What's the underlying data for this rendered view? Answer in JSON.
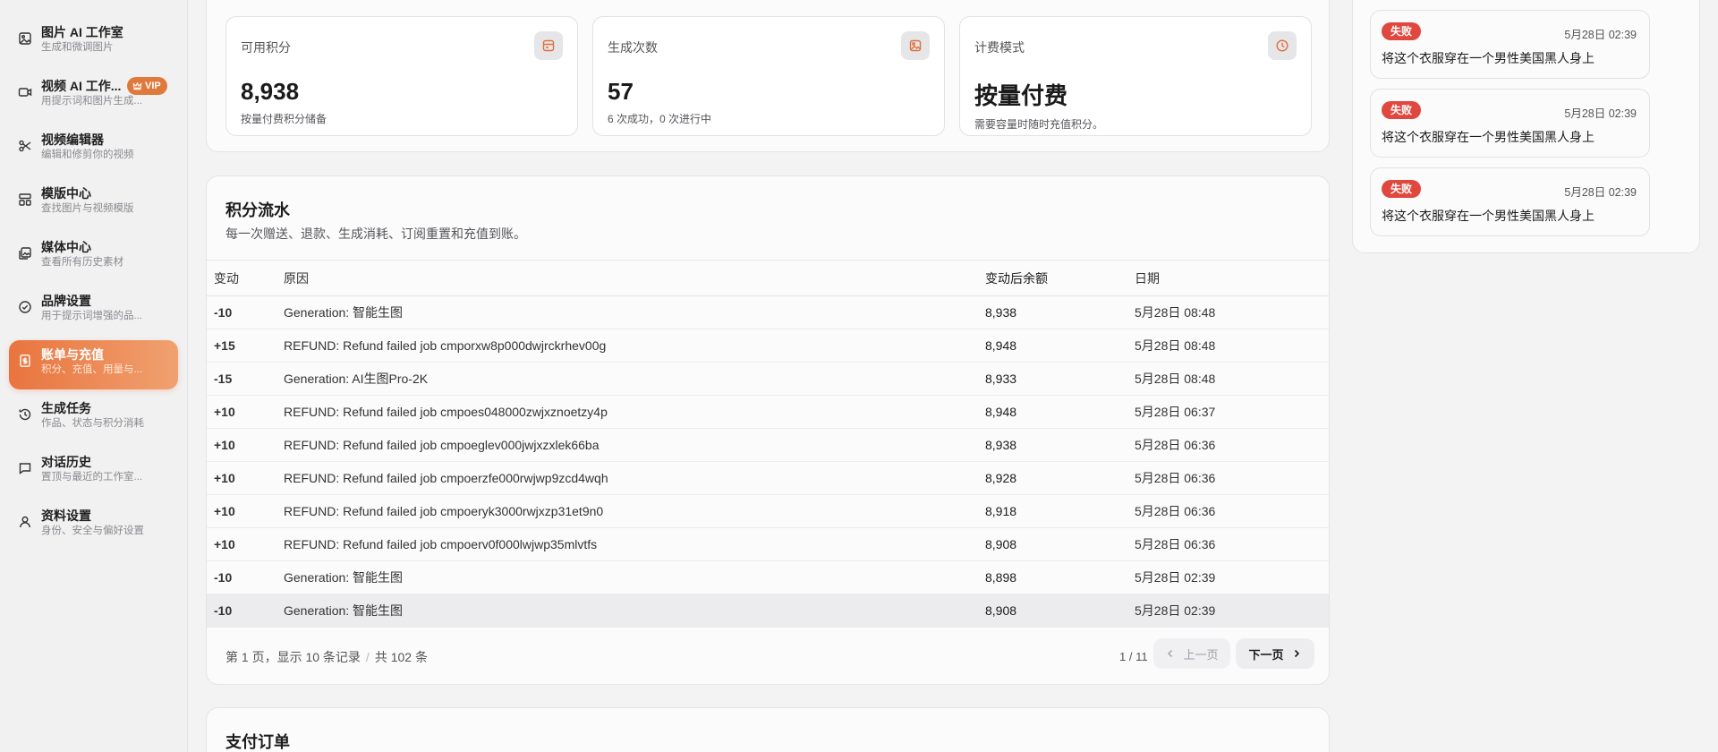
{
  "sidebar": {
    "items": [
      {
        "title": "图片 AI 工作室",
        "sub": "生成和微调图片",
        "icon": "image-icon"
      },
      {
        "title": "视频 AI 工作...",
        "sub": "用提示词和图片生成...",
        "icon": "video-icon",
        "badge": "VIP"
      },
      {
        "title": "视频编辑器",
        "sub": "编辑和修剪你的视频",
        "icon": "scissors-icon"
      },
      {
        "title": "模版中心",
        "sub": "查找图片与视频模版",
        "icon": "template-icon"
      },
      {
        "title": "媒体中心",
        "sub": "查看所有历史素材",
        "icon": "media-icon"
      },
      {
        "title": "品牌设置",
        "sub": "用于提示词增强的品...",
        "icon": "check-circle-icon"
      },
      {
        "title": "账单与充值",
        "sub": "积分、充值、用量与...",
        "icon": "billing-icon",
        "active": true
      },
      {
        "title": "生成任务",
        "sub": "作品、状态与积分消耗",
        "icon": "history-icon"
      },
      {
        "title": "对话历史",
        "sub": "置顶与最近的工作室...",
        "icon": "chat-icon"
      },
      {
        "title": "资料设置",
        "sub": "身份、安全与偏好设置",
        "icon": "user-icon"
      }
    ]
  },
  "stats": [
    {
      "label": "可用积分",
      "value": "8,938",
      "sub": "按量付费积分储备",
      "icon": "wallet-icon"
    },
    {
      "label": "生成次数",
      "value": "57",
      "sub": "6 次成功，0 次进行中",
      "icon": "image-icon"
    },
    {
      "label": "计费模式",
      "value": "按量付费",
      "sub": "需要容量时随时充值积分。",
      "icon": "clock-icon"
    }
  ],
  "ledger": {
    "title": "积分流水",
    "desc": "每一次赠送、退款、生成消耗、订阅重置和充值到账。",
    "headers": [
      "变动",
      "原因",
      "变动后余额",
      "日期"
    ],
    "rows": [
      {
        "amount": "-10",
        "reason": "Generation: 智能生图",
        "balance": "8,938",
        "date": "5月28日 08:48"
      },
      {
        "amount": "+15",
        "reason": "REFUND: Refund failed job cmporxw8p000dwjrckrhev00g",
        "balance": "8,948",
        "date": "5月28日 08:48"
      },
      {
        "amount": "-15",
        "reason": "Generation: AI生图Pro-2K",
        "balance": "8,933",
        "date": "5月28日 08:48"
      },
      {
        "amount": "+10",
        "reason": "REFUND: Refund failed job cmpoes048000zwjxznoetzy4p",
        "balance": "8,948",
        "date": "5月28日 06:37"
      },
      {
        "amount": "+10",
        "reason": "REFUND: Refund failed job cmpoeglev000jwjxzxlek66ba",
        "balance": "8,938",
        "date": "5月28日 06:36"
      },
      {
        "amount": "+10",
        "reason": "REFUND: Refund failed job cmpoerzfe000rwjwp9zcd4wqh",
        "balance": "8,928",
        "date": "5月28日 06:36"
      },
      {
        "amount": "+10",
        "reason": "REFUND: Refund failed job cmpoeryk3000rwjxzp31et9n0",
        "balance": "8,918",
        "date": "5月28日 06:36"
      },
      {
        "amount": "+10",
        "reason": "REFUND: Refund failed job cmpoerv0f000lwjwp35mlvtfs",
        "balance": "8,908",
        "date": "5月28日 06:36"
      },
      {
        "amount": "-10",
        "reason": "Generation: 智能生图",
        "balance": "8,898",
        "date": "5月28日 02:39"
      },
      {
        "amount": "-10",
        "reason": "Generation: 智能生图",
        "balance": "8,908",
        "date": "5月28日 02:39"
      }
    ],
    "pager": {
      "info": "第 1 页，显示 10 条记录",
      "total": "共 102 条",
      "page_count": "1 / 11",
      "prev_label": "上一页",
      "next_label": "下一页"
    }
  },
  "orders": {
    "title": "支付订单"
  },
  "tasks": [
    {
      "status": "失败",
      "time": "5月28日 02:39",
      "prompt": "将这个衣服穿在一个男性美国黑人身上"
    },
    {
      "status": "失败",
      "time": "5月28日 02:39",
      "prompt": "将这个衣服穿在一个男性美国黑人身上"
    },
    {
      "status": "失败",
      "time": "5月28日 02:39",
      "prompt": "将这个衣服穿在一个男性美国黑人身上"
    }
  ],
  "colors": {
    "accent": "#e9743e",
    "negative": "#d9352c",
    "failed": "#e0473e"
  }
}
